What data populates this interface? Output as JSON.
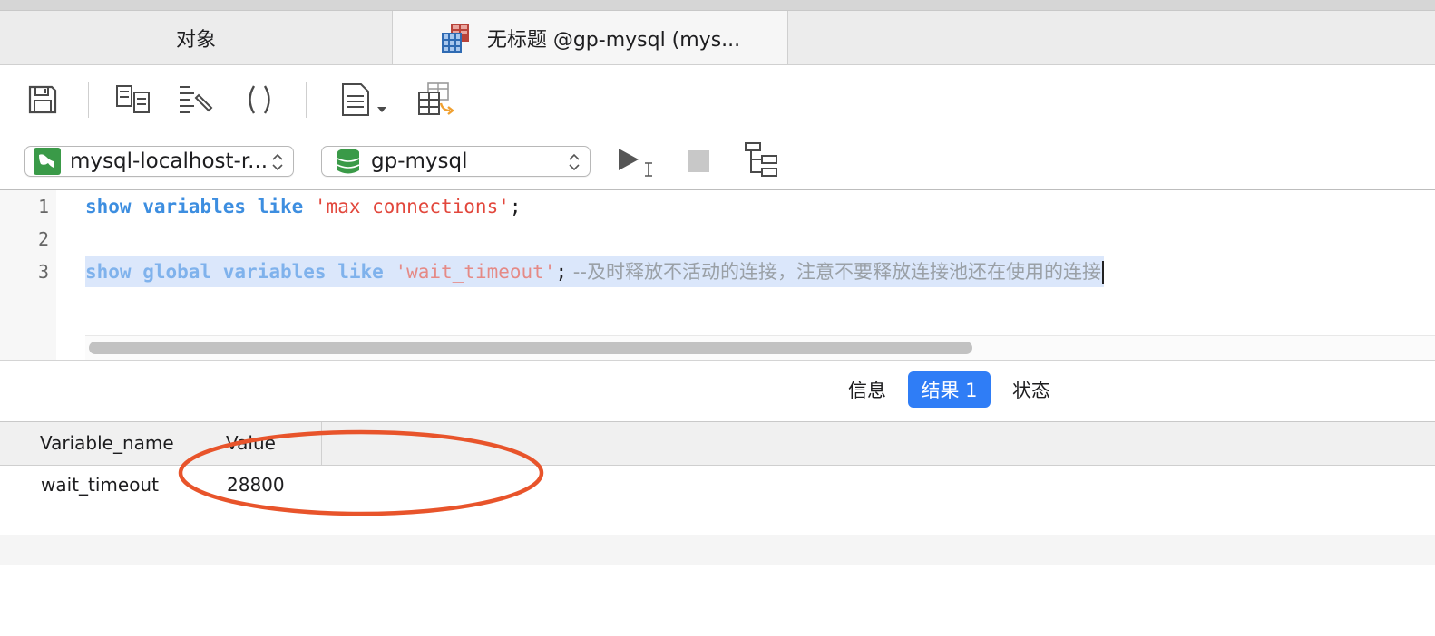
{
  "tabs": {
    "objects_label": "对象",
    "query_label": "无标题 @gp-mysql (mys..."
  },
  "connection": {
    "server_label": "mysql-localhost-r...",
    "database_label": "gp-mysql"
  },
  "editor": {
    "line_numbers": [
      "1",
      "2",
      "3"
    ],
    "line1": {
      "kw1": "show",
      "kw2": "variables",
      "kw3": "like",
      "str": "'max_connections'",
      "end": ";"
    },
    "line3": {
      "kw1": "show",
      "kw2": "global",
      "kw3": "variables",
      "kw4": "like",
      "str": "'wait_timeout'",
      "end": ";",
      "comment": " --及时释放不活动的连接，注意不要释放连接池还在使用的连接"
    }
  },
  "result_tabs": {
    "info_label": "信息",
    "result_label": "结果 1",
    "status_label": "状态"
  },
  "grid": {
    "columns": [
      "Variable_name",
      "Value"
    ],
    "rows": [
      [
        "wait_timeout",
        "28800"
      ]
    ]
  },
  "colors": {
    "accent": "#2f7df6",
    "keyword": "#3d8ee0",
    "string": "#e2473c",
    "annotation": "#e8542b"
  },
  "icons": {
    "save": "save-icon",
    "query-builder": "query-builder-icon",
    "beautify": "beautify-sql-icon",
    "parentheses": "parentheses-icon",
    "snippet": "snippet-icon",
    "table-export": "table-export-icon",
    "run": "run-icon",
    "stop": "stop-icon",
    "explain": "explain-icon"
  }
}
